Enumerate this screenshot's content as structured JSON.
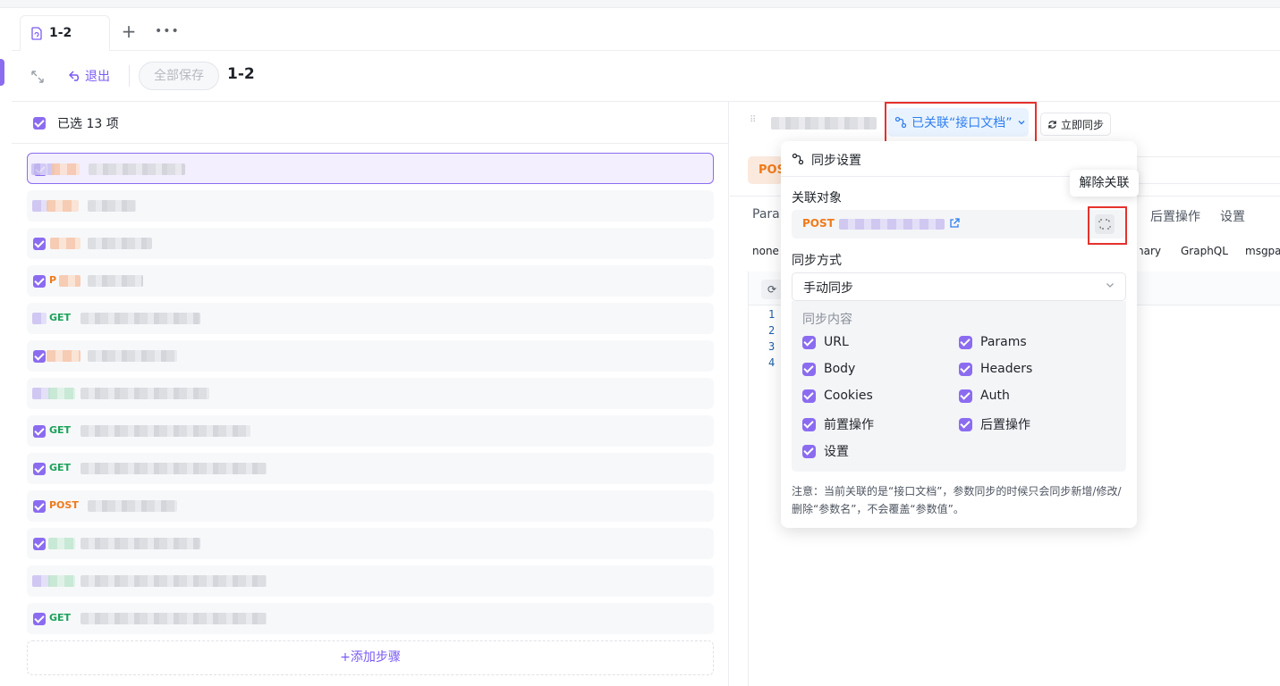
{
  "tabs": [
    {
      "label": "1-2"
    }
  ],
  "toolbar": {
    "exit_label": "退出",
    "save_all_label": "全部保存",
    "title": "1-2"
  },
  "left": {
    "selected_count": "已选 13 项",
    "add_step_label": "添加步骤"
  },
  "steps": [
    {
      "method": ""
    },
    {
      "method": ""
    },
    {
      "method": ""
    },
    {
      "method": "P"
    },
    {
      "method": "GET"
    },
    {
      "method": ""
    },
    {
      "method": ""
    },
    {
      "method": "GET"
    },
    {
      "method": "GET"
    },
    {
      "method": "POST"
    },
    {
      "method": ""
    },
    {
      "method": ""
    },
    {
      "method": "GET"
    }
  ],
  "right": {
    "linked_label": "已关联“接口文档”",
    "sync_now_label": "立即同步",
    "method_box": "POST",
    "tabs": [
      "Params",
      "后置操作",
      "设置"
    ],
    "body_types": [
      "none",
      "binary",
      "GraphQL",
      "msgpack"
    ],
    "line_numbers": [
      "1",
      "2",
      "3",
      "4"
    ]
  },
  "popover": {
    "title": "同步设置",
    "linked_target_label": "关联对象",
    "target_method": "POST",
    "sync_mode_label": "同步方式",
    "sync_mode_value": "手动同步",
    "sync_content_label": "同步内容",
    "options_left": [
      "URL",
      "Body",
      "Cookies",
      "前置操作",
      "设置"
    ],
    "options_right": [
      "Params",
      "Headers",
      "Auth",
      "后置操作"
    ],
    "note": "注意：当前关联的是“接口文档”，参数同步的时候只会同步新增/修改/删除“参数名”，不会覆盖“参数值”。"
  },
  "tooltip": {
    "unlink": "解除关联"
  },
  "colors": {
    "accent": "#8b6cf0",
    "link_blue": "#2f7ef0",
    "post_orange": "#f07a1a",
    "get_green": "#1ba35a",
    "highlight_red": "#e5322d"
  }
}
